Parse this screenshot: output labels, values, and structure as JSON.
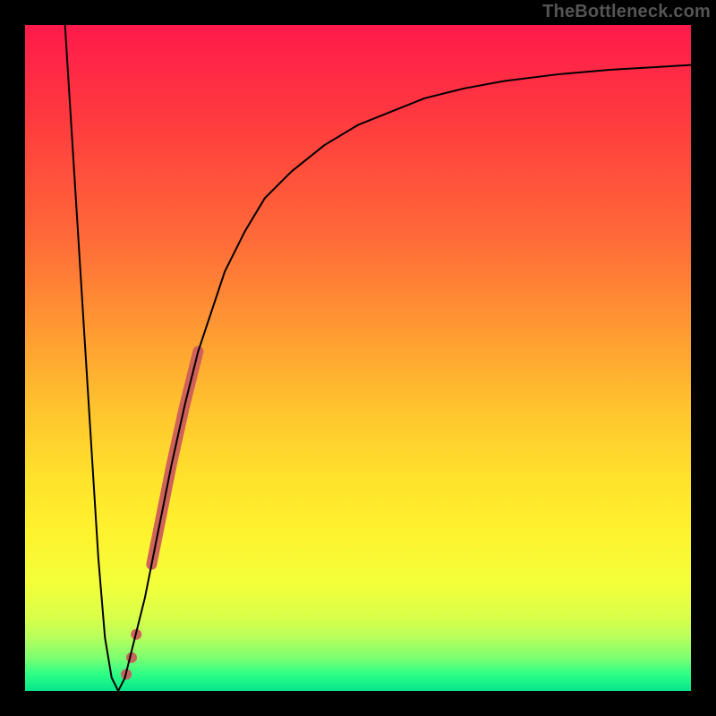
{
  "watermark": "TheBottleneck.com",
  "colors": {
    "frame": "#000000",
    "curve": "#000000",
    "highlight": "#cd5c5c",
    "gradient_top": "#ff1a4b",
    "gradient_bottom": "#06e58a"
  },
  "chart_data": {
    "type": "line",
    "title": "",
    "xlabel": "",
    "ylabel": "",
    "xlim": [
      0,
      100
    ],
    "ylim": [
      0,
      100
    ],
    "grid": false,
    "legend": false,
    "series": [
      {
        "name": "bottleneck-curve",
        "x": [
          6,
          7,
          8,
          9,
          10,
          11,
          12,
          13,
          14,
          15,
          16,
          18,
          20,
          22,
          24,
          26,
          28,
          30,
          33,
          36,
          40,
          45,
          50,
          55,
          60,
          66,
          72,
          80,
          88,
          95,
          100
        ],
        "y": [
          100,
          84,
          68,
          52,
          36,
          20,
          8,
          2,
          0,
          2,
          6,
          14,
          24,
          34,
          43,
          51,
          57,
          63,
          69,
          74,
          78,
          82,
          85,
          87,
          89,
          90.5,
          91.6,
          92.6,
          93.3,
          93.7,
          94
        ]
      }
    ],
    "highlight": {
      "name": "highlighted-range",
      "x": [
        19,
        20,
        21,
        22,
        23,
        24,
        25,
        26
      ],
      "y": [
        19,
        24,
        29,
        34,
        38.5,
        43,
        47,
        51
      ]
    },
    "highlight_dots": {
      "x": [
        15.2,
        16.0,
        16.7
      ],
      "y": [
        2.5,
        5.0,
        8.5
      ]
    },
    "minimum": {
      "x": 14,
      "y": 0
    }
  }
}
